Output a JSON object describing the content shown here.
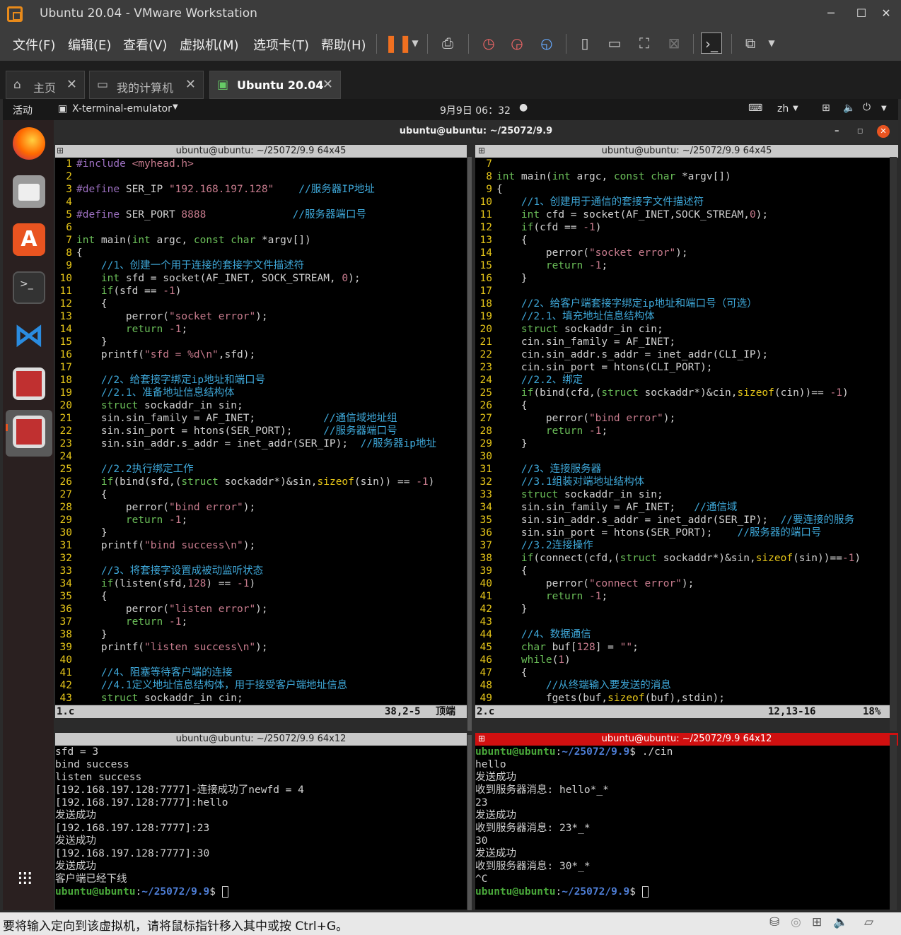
{
  "window": {
    "title": "Ubuntu 20.04 - VMware Workstation"
  },
  "menu": [
    "文件(F)",
    "编辑(E)",
    "查看(V)",
    "虚拟机(M)",
    "选项卡(T)",
    "帮助(H)"
  ],
  "tabs": [
    {
      "label": "主页",
      "icon": "home-icon"
    },
    {
      "label": "我的计算机",
      "icon": "computer-icon"
    },
    {
      "label": "Ubuntu 20.04",
      "icon": "vm-icon"
    }
  ],
  "gnome": {
    "activities": "活动",
    "app": "X-terminal-emulator",
    "clock": "9月9日 06：32",
    "lang": "zh"
  },
  "terminal": {
    "title": "ubuntu@ubuntu: ~/25072/9.9"
  },
  "panes": {
    "tl_title": "ubuntu@ubuntu: ~/25072/9.9 64x45",
    "tr_title": "ubuntu@ubuntu: ~/25072/9.9 64x45",
    "bl_title": "ubuntu@ubuntu: ~/25072/9.9 64x12",
    "br_title": "ubuntu@ubuntu: ~/25072/9.9 64x12"
  },
  "editor_left": {
    "file": "1.c",
    "pos": "38,2-5",
    "scroll": "顶端",
    "lines": [
      [
        "1",
        "#include <myhead.h>"
      ],
      [
        "2",
        ""
      ],
      [
        "3",
        "#define SER_IP \"192.168.197.128\"    //服务器IP地址"
      ],
      [
        "4",
        ""
      ],
      [
        "5",
        "#define SER_PORT 8888              //服务器端口号"
      ],
      [
        "6",
        ""
      ],
      [
        "7",
        "int main(int argc, const char *argv[])"
      ],
      [
        "8",
        "{"
      ],
      [
        "9",
        "    //1、创建一个用于连接的套接字文件描述符"
      ],
      [
        "10",
        "    int sfd = socket(AF_INET, SOCK_STREAM, 0);"
      ],
      [
        "11",
        "    if(sfd == -1)"
      ],
      [
        "12",
        "    {"
      ],
      [
        "13",
        "        perror(\"socket error\");"
      ],
      [
        "14",
        "        return -1;"
      ],
      [
        "15",
        "    }"
      ],
      [
        "16",
        "    printf(\"sfd = %d\\n\",sfd);"
      ],
      [
        "17",
        ""
      ],
      [
        "18",
        "    //2、给套接字绑定ip地址和端口号"
      ],
      [
        "19",
        "    //2.1、准备地址信息结构体"
      ],
      [
        "20",
        "    struct sockaddr_in sin;"
      ],
      [
        "21",
        "    sin.sin_family = AF_INET;           //通信域地址组"
      ],
      [
        "22",
        "    sin.sin_port = htons(SER_PORT);     //服务器端口号"
      ],
      [
        "23",
        "    sin.sin_addr.s_addr = inet_addr(SER_IP);  //服务器ip地址"
      ],
      [
        "24",
        ""
      ],
      [
        "25",
        "    //2.2执行绑定工作"
      ],
      [
        "26",
        "    if(bind(sfd,(struct sockaddr*)&sin,sizeof(sin)) == -1)"
      ],
      [
        "27",
        "    {"
      ],
      [
        "28",
        "        perror(\"bind error\");"
      ],
      [
        "29",
        "        return -1;"
      ],
      [
        "30",
        "    }"
      ],
      [
        "31",
        "    printf(\"bind success\\n\");"
      ],
      [
        "32",
        ""
      ],
      [
        "33",
        "    //3、将套接字设置成被动监听状态"
      ],
      [
        "34",
        "    if(listen(sfd,128) == -1)"
      ],
      [
        "35",
        "    {"
      ],
      [
        "36",
        "        perror(\"listen error\");"
      ],
      [
        "37",
        "        return -1;"
      ],
      [
        "38",
        "    }"
      ],
      [
        "39",
        "    printf(\"listen success\\n\");"
      ],
      [
        "40",
        ""
      ],
      [
        "41",
        "    //4、阻塞等待客户端的连接"
      ],
      [
        "42",
        "    //4.1定义地址信息结构体，用于接受客户端地址信息"
      ],
      [
        "43",
        "    struct sockaddr_in cin;"
      ]
    ]
  },
  "editor_right": {
    "file": "2.c",
    "pos": "12,13-16",
    "scroll": "18%",
    "lines": [
      [
        "7",
        ""
      ],
      [
        "8",
        "int main(int argc, const char *argv[])"
      ],
      [
        "9",
        "{"
      ],
      [
        "10",
        "    //1、创建用于通信的套接字文件描述符"
      ],
      [
        "11",
        "    int cfd = socket(AF_INET,SOCK_STREAM,0);"
      ],
      [
        "12",
        "    if(cfd == -1)"
      ],
      [
        "13",
        "    {"
      ],
      [
        "14",
        "        perror(\"socket error\");"
      ],
      [
        "15",
        "        return -1;"
      ],
      [
        "16",
        "    }"
      ],
      [
        "17",
        ""
      ],
      [
        "18",
        "    //2、给客户端套接字绑定ip地址和端口号（可选）"
      ],
      [
        "19",
        "    //2.1、填充地址信息结构体"
      ],
      [
        "20",
        "    struct sockaddr_in cin;"
      ],
      [
        "21",
        "    cin.sin_family = AF_INET;"
      ],
      [
        "22",
        "    cin.sin_addr.s_addr = inet_addr(CLI_IP);"
      ],
      [
        "23",
        "    cin.sin_port = htons(CLI_PORT);"
      ],
      [
        "24",
        "    //2.2、绑定"
      ],
      [
        "25",
        "    if(bind(cfd,(struct sockaddr*)&cin,sizeof(cin))== -1)"
      ],
      [
        "26",
        "    {"
      ],
      [
        "27",
        "        perror(\"bind error\");"
      ],
      [
        "28",
        "        return -1;"
      ],
      [
        "29",
        "    }"
      ],
      [
        "30",
        ""
      ],
      [
        "31",
        "    //3、连接服务器"
      ],
      [
        "32",
        "    //3.1组装对端地址结构体"
      ],
      [
        "33",
        "    struct sockaddr_in sin;"
      ],
      [
        "34",
        "    sin.sin_family = AF_INET;   //通信域"
      ],
      [
        "35",
        "    sin.sin_addr.s_addr = inet_addr(SER_IP);  //要连接的服务"
      ],
      [
        "36",
        "    sin.sin_port = htons(SER_PORT);    //服务器的端口号"
      ],
      [
        "37",
        "    //3.2连接操作"
      ],
      [
        "38",
        "    if(connect(cfd,(struct sockaddr*)&sin,sizeof(sin))==-1)"
      ],
      [
        "39",
        "    {"
      ],
      [
        "40",
        "        perror(\"connect error\");"
      ],
      [
        "41",
        "        return -1;"
      ],
      [
        "42",
        "    }"
      ],
      [
        "43",
        ""
      ],
      [
        "44",
        "    //4、数据通信"
      ],
      [
        "45",
        "    char buf[128] = \"\";"
      ],
      [
        "46",
        "    while(1)"
      ],
      [
        "47",
        "    {"
      ],
      [
        "48",
        "        //从终端输入要发送的消息"
      ],
      [
        "49",
        "        fgets(buf,sizeof(buf),stdin);"
      ]
    ]
  },
  "term_left": [
    "sfd = 3",
    "bind success",
    "listen success",
    "[192.168.197.128:7777]-连接成功了newfd = 4",
    "[192.168.197.128:7777]:hello",
    "发送成功",
    "[192.168.197.128:7777]:23",
    "发送成功",
    "[192.168.197.128:7777]:30",
    "发送成功",
    "客户端已经下线"
  ],
  "term_right": [
    "hello",
    "发送成功",
    "收到服务器消息: hello*_*",
    "23",
    "发送成功",
    "收到服务器消息: 23*_*",
    "30",
    "发送成功",
    "收到服务器消息: 30*_*",
    "^C"
  ],
  "prompt": {
    "user": "ubuntu@ubuntu",
    "path": "~/25072/9.9",
    "sign": "$",
    "cmd_right_first": "./cin"
  },
  "statusbar": "要将输入定向到该虚拟机，请将鼠标指针移入其中或按 Ctrl+G。"
}
